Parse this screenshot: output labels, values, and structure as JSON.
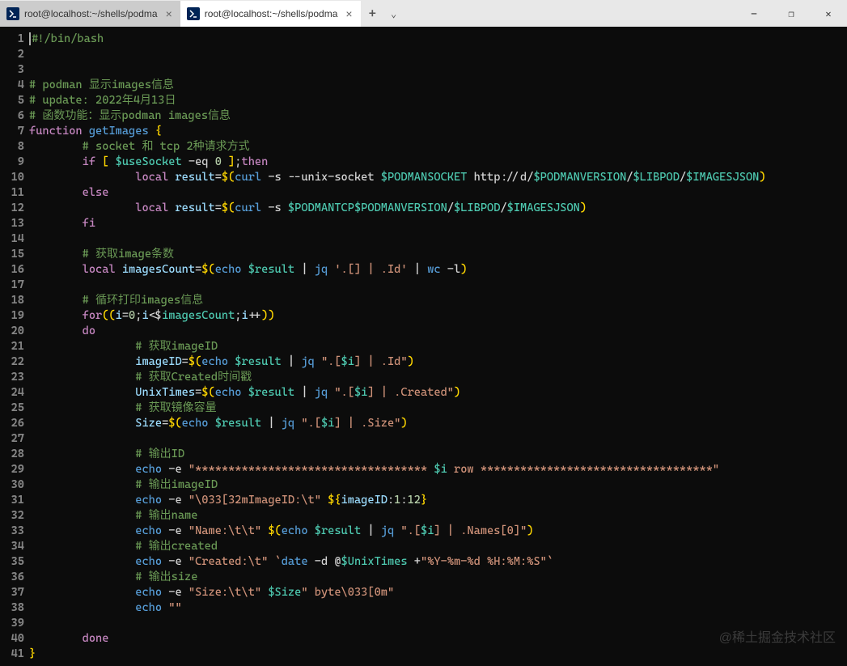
{
  "tabs": [
    {
      "title": "root@localhost:~/shells/podma"
    },
    {
      "title": "root@localhost:~/shells/podma"
    }
  ],
  "watermark": "@稀土掘金技术社区",
  "lines": {
    "l1": {
      "n": "1",
      "shebang": "#!/bin/bash"
    },
    "l2": {
      "n": "2"
    },
    "l3": {
      "n": "3"
    },
    "l4": {
      "n": "4",
      "c": "# podman 显示images信息"
    },
    "l5": {
      "n": "5",
      "c": "# update: 2022年4月13日"
    },
    "l6": {
      "n": "6",
      "c": "# 函数功能：显示podman images信息"
    },
    "l7": {
      "n": "7",
      "kw": "function",
      "name": "getImages",
      "brace": "{"
    },
    "l8": {
      "n": "8",
      "c": "# socket 和 tcp 2种请求方式"
    },
    "l9": {
      "n": "9",
      "if": "if",
      "lb": "[",
      "var": "$useSocket",
      "op": "-eq",
      "num": "0",
      "rb": "]",
      "semi": ";",
      "then": "then"
    },
    "l10": {
      "n": "10",
      "local": "local",
      "var": "result",
      "eq": "=",
      "d1": "$(",
      "curl": "curl",
      "flags": "-s --unix-socket",
      "v1": "$PODMANSOCKET",
      "http": "http://d/",
      "v2": "$PODMANVERSION",
      "s1": "/",
      "v3": "$LIBPOD",
      "s2": "/",
      "v4": "$IMAGESJSON",
      "d2": ")"
    },
    "l11": {
      "n": "11",
      "else": "else"
    },
    "l12": {
      "n": "12",
      "local": "local",
      "var": "result",
      "eq": "=",
      "d1": "$(",
      "curl": "curl",
      "flags": "-s",
      "v1": "$PODMANTCP",
      "v2": "$PODMANVERSION",
      "s1": "/",
      "v3": "$LIBPOD",
      "s2": "/",
      "v4": "$IMAGESJSON",
      "d2": ")"
    },
    "l13": {
      "n": "13",
      "fi": "fi"
    },
    "l14": {
      "n": "14"
    },
    "l15": {
      "n": "15",
      "c": "# 获取image条数"
    },
    "l16": {
      "n": "16",
      "local": "local",
      "var": "imagesCount",
      "eq": "=",
      "d1": "$(",
      "echo": "echo",
      "v1": "$result",
      "p1": "|",
      "jq": "jq",
      "str": "'.[] | .Id'",
      "p2": "|",
      "wc": "wc",
      "opt": "-l",
      "d2": ")"
    },
    "l17": {
      "n": "17"
    },
    "l18": {
      "n": "18",
      "c": "# 循环打印images信息"
    },
    "l19": {
      "n": "19",
      "for": "for",
      "p1": "((",
      "a": "i",
      "eq": "=",
      "z": "0",
      "sc1": ";",
      "b": "i",
      "lt": "<",
      "v": "$imagesCount",
      "sc2": ";",
      "c": "i",
      "pp": "++",
      "p2": "))"
    },
    "l20": {
      "n": "20",
      "do": "do"
    },
    "l21": {
      "n": "21",
      "c": "# 获取imageID"
    },
    "l22": {
      "n": "22",
      "var": "imageID",
      "eq": "=",
      "d1": "$(",
      "echo": "echo",
      "v1": "$result",
      "p1": "|",
      "jq": "jq",
      "q1": "\".[",
      "vi": "$i",
      "q2": "] | .Id\"",
      "d2": ")"
    },
    "l23": {
      "n": "23",
      "c": "# 获取Created时间戳"
    },
    "l24": {
      "n": "24",
      "var": "UnixTimes",
      "eq": "=",
      "d1": "$(",
      "echo": "echo",
      "v1": "$result",
      "p1": "|",
      "jq": "jq",
      "q1": "\".[",
      "vi": "$i",
      "q2": "] | .Created\"",
      "d2": ")"
    },
    "l25": {
      "n": "25",
      "c": "# 获取镜像容量"
    },
    "l26": {
      "n": "26",
      "var": "Size",
      "eq": "=",
      "d1": "$(",
      "echo": "echo",
      "v1": "$result",
      "p1": "|",
      "jq": "jq",
      "q1": "\".[",
      "vi": "$i",
      "q2": "] | .Size\"",
      "d2": ")"
    },
    "l27": {
      "n": "27"
    },
    "l28": {
      "n": "28",
      "c": "# 输出ID"
    },
    "l29": {
      "n": "29",
      "echo": "echo",
      "opt": "-e",
      "q1": "\"*********************************** ",
      "vi": "$i",
      "q2": " row ***********************************\""
    },
    "l30": {
      "n": "30",
      "c": "# 输出imageID"
    },
    "l31": {
      "n": "31",
      "echo": "echo",
      "opt": "-e",
      "q1": "\"\\033[32mImageID:\\t\"",
      "d1": "${",
      "v": "imageID",
      "c1": ":",
      "n1": "1",
      "c2": ":",
      "n2": "12",
      "d2": "}"
    },
    "l32": {
      "n": "32",
      "c": "# 输出name"
    },
    "l33": {
      "n": "33",
      "echo": "echo",
      "opt": "-e",
      "q1": "\"Name:\\t\\t\"",
      "d1": "$(",
      "echo2": "echo",
      "v1": "$result",
      "p1": "|",
      "jq": "jq",
      "q2": "\".[",
      "vi": "$i",
      "q3": "] | .Names[0]\"",
      "d2": ")"
    },
    "l34": {
      "n": "34",
      "c": "# 输出created"
    },
    "l35": {
      "n": "35",
      "echo": "echo",
      "opt": "-e",
      "q1": "\"Created:\\t\"",
      "bt1": "`",
      "date": "date",
      "dopt": "-d @",
      "v": "$UnixTimes",
      "plus": "+",
      "q2": "\"%Y-%m-%d %H:%M:%S\"",
      "bt2": "`"
    },
    "l36": {
      "n": "36",
      "c": "# 输出size"
    },
    "l37": {
      "n": "37",
      "echo": "echo",
      "opt": "-e",
      "q1": "\"Size:\\t\\t\"",
      "v": "$Size",
      "q2": "\" byte\\033[0m\""
    },
    "l38": {
      "n": "38",
      "echo": "echo",
      "q": "\"\""
    },
    "l39": {
      "n": "39"
    },
    "l40": {
      "n": "40",
      "done": "done"
    },
    "l41": {
      "n": "41",
      "brace": "}"
    }
  }
}
